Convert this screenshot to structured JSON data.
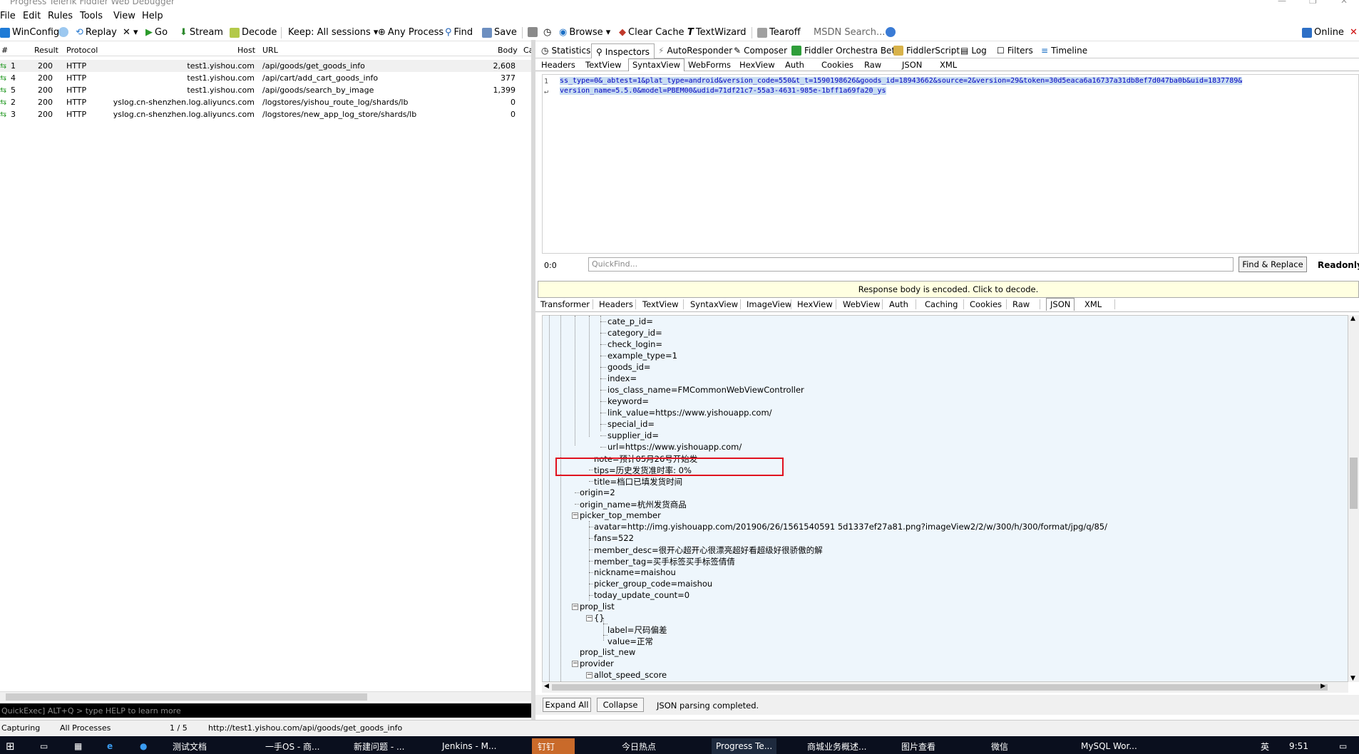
{
  "window": {
    "title": "Progress Telerik Fiddler Web Debugger"
  },
  "menu": [
    "File",
    "Edit",
    "Rules",
    "Tools",
    "View",
    "Help"
  ],
  "toolbar": {
    "winconfig": "WinConfig",
    "replay": "Replay",
    "remove": "✕ ▾",
    "go": "Go",
    "stream": "Stream",
    "decode": "Decode",
    "keep": "Keep: All sessions ▾",
    "any_process": "Any Process",
    "find": "Find",
    "save": "Save",
    "browse": "Browse ▾",
    "clear_cache": "Clear Cache",
    "textwizard": "TextWizard",
    "tearoff": "Tearoff",
    "msdn_search": "MSDN Search...",
    "online": "Online"
  },
  "sessions": {
    "headers": {
      "num": "#",
      "result": "Result",
      "protocol": "Protocol",
      "host": "Host",
      "url": "URL",
      "body": "Body",
      "caching": "Ca"
    },
    "rows": [
      {
        "num": "1",
        "result": "200",
        "protocol": "HTTP",
        "host": "test1.yishou.com",
        "url": "/api/goods/get_goods_info",
        "body": "2,608"
      },
      {
        "num": "4",
        "result": "200",
        "protocol": "HTTP",
        "host": "test1.yishou.com",
        "url": "/api/cart/add_cart_goods_info",
        "body": "377"
      },
      {
        "num": "5",
        "result": "200",
        "protocol": "HTTP",
        "host": "test1.yishou.com",
        "url": "/api/goods/search_by_image",
        "body": "1,399"
      },
      {
        "num": "2",
        "result": "200",
        "protocol": "HTTP",
        "host": "yslog.cn-shenzhen.log.aliyuncs.com",
        "url": "/logstores/yishou_route_log/shards/lb",
        "body": "0"
      },
      {
        "num": "3",
        "result": "200",
        "protocol": "HTTP",
        "host": "yslog.cn-shenzhen.log.aliyuncs.com",
        "url": "/logstores/new_app_log_store/shards/lb",
        "body": "0"
      }
    ]
  },
  "quickexec": "QuickExec] ALT+Q > type HELP to learn more",
  "status": {
    "capturing": "Capturing",
    "processes": "All Processes",
    "count": "1 / 5",
    "url": "http://test1.yishou.com/api/goods/get_goods_info"
  },
  "right_tabs": [
    "Statistics",
    "Inspectors",
    "AutoResponder",
    "Composer",
    "Fiddler Orchestra Beta",
    "FiddlerScript",
    "Log",
    "Filters",
    "Timeline"
  ],
  "request_tabs": [
    "Headers",
    "TextView",
    "SyntaxView",
    "WebForms",
    "HexView",
    "Auth",
    "Cookies",
    "Raw",
    "JSON",
    "XML"
  ],
  "request_text": {
    "line_no": "1",
    "line1": "ss_type=0&_abtest=1&plat_type=android&version_code=550&t_t=1590198626&goods_id=18943662&source=2&version=29&token=30d5eaca6a16737a31db8ef7d047ba0b&uid=1837789&",
    "line2": "version_name=5.5.0&model=PBEM00&udid=71df21c7-55a3-4631-985e-1bff1a69fa20_ys"
  },
  "find": {
    "position": "0:0",
    "placeholder": "QuickFind...",
    "button": "Find & Replace",
    "mode": "Readonly"
  },
  "encoded_notice": "Response body is encoded. Click to decode.",
  "response_tabs": [
    "Transformer",
    "Headers",
    "TextView",
    "SyntaxView",
    "ImageView",
    "HexView",
    "WebView",
    "Auth",
    "Caching",
    "Cookies",
    "Raw",
    "JSON",
    "XML"
  ],
  "tree": [
    "cate_p_id=",
    "category_id=",
    "check_login=",
    "example_type=1",
    "goods_id=",
    "index=",
    "ios_class_name=FMCommonWebViewController",
    "keyword=",
    "link_value=https://www.yishouapp.com/",
    "special_id=",
    "supplier_id=",
    "url=https://www.yishouapp.com/",
    "note=预计05月26号开始发",
    "tips=历史发货准时率: 0%",
    "title=档口已填发货时间",
    "origin=2",
    "origin_name=杭州发货商品",
    "picker_top_member",
    "avatar=http://img.yishouapp.com/201906/26/1561540591 5d1337ef27a81.png?imageView2/2/w/300/h/300/format/jpg/q/85/",
    "fans=522",
    "member_desc=很开心超开心很漂亮超好看超级好很骄傲的解",
    "member_tag=买手标签买手标签倩倩",
    "nickname=maishou",
    "picker_group_code=maishou",
    "today_update_count=0",
    "prop_list",
    "{}",
    "label=尺码偏差",
    "value=正常",
    "prop_list_new",
    "provider",
    "allot_speed_score"
  ],
  "bottom": {
    "expand_all": "Expand All",
    "collapse": "Collapse",
    "status": "JSON parsing completed."
  },
  "taskbar": [
    "测试文档",
    "一手OS - 商...",
    "新建问题 - ...",
    "Jenkins - M...",
    "钉钉",
    "今日热点",
    "Progress Te...",
    "商城业务概述...",
    "图片查看",
    "微信",
    "MySQL Wor..."
  ],
  "clock": {
    "time": "9:51",
    "lang": "英"
  },
  "colors": {
    "highlight": "#e0101e",
    "code_bg": "#c8ddf2",
    "tree_bg": "#eef6fc",
    "notice_bg": "#ffffe1",
    "taskbar": "#0a0f1e"
  }
}
